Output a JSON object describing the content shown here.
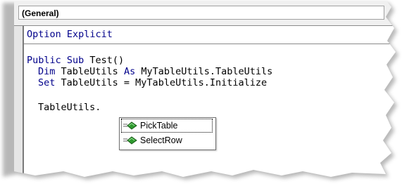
{
  "toolbar": {
    "object_combo_value": "(General)"
  },
  "code": {
    "declarations_line": {
      "keyword": "Option Explicit",
      "rest": ""
    },
    "lines": [
      {
        "keyword": "Public Sub",
        "rest": " Test()"
      },
      {
        "keyword": "Dim",
        "rest": " TableUtils ",
        "keyword2": "As",
        "rest2": " MyTableUtils.TableUtils"
      },
      {
        "keyword": "Set",
        "rest": " TableUtils = MyTableUtils.Initialize"
      },
      {
        "keyword": "",
        "rest": "TableUtils."
      }
    ]
  },
  "intellisense": {
    "items": [
      {
        "label": "PickTable",
        "icon": "method-icon",
        "selected": true
      },
      {
        "label": "SelectRow",
        "icon": "method-icon",
        "selected": false
      }
    ]
  },
  "colors": {
    "keyword": "#00008b",
    "method_icon_green": "#2e9a2e",
    "frame_shadow": "#bdbdbd"
  }
}
